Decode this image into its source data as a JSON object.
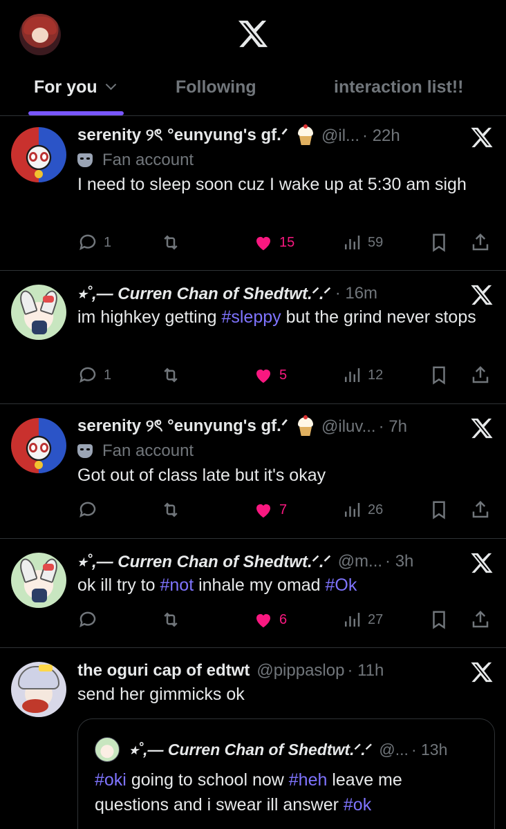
{
  "header": {
    "tabs": [
      "For you",
      "Following",
      "interaction list!!"
    ],
    "active_tab": "For you"
  },
  "posts": [
    {
      "name": "serenity ୨ৎ °eunyung's gf.ᐟ",
      "handle": "@il...",
      "time": "· 22h",
      "badge": "Fan account",
      "text": "I need to sleep soon cuz I wake up at 5:30 am sigh",
      "reply_count": "1",
      "like_count": "15",
      "view_count": "59"
    },
    {
      "name": "⭑˚,— Curren Chan of Shedtwt.ᐟ.ᐟ",
      "time": "· 16m",
      "text_parts": [
        "im highkey getting ",
        "#sleppy",
        " but the grind never stops"
      ],
      "reply_count": "1",
      "like_count": "5",
      "view_count": "12"
    },
    {
      "name": "serenity ୨ৎ °eunyung's gf.ᐟ",
      "handle": "@iluv...",
      "time": "· 7h",
      "badge": "Fan account",
      "text": "Got out of class late but it's okay",
      "like_count": "7",
      "view_count": "26"
    },
    {
      "name": "⭑˚,— Curren Chan of Shedtwt.ᐟ.ᐟ",
      "handle": "@m...",
      "time": "· 3h",
      "text_parts": [
        "ok ill try to ",
        "#not",
        " inhale my omad ",
        "#Ok"
      ],
      "like_count": "6",
      "view_count": "27"
    },
    {
      "name": "the oguri cap of edtwt",
      "handle": "@pippaslop",
      "time": "· 11h",
      "text": "send her gimmicks ok",
      "quote": {
        "name": "⭑˚,— Curren Chan of Shedtwt.ᐟ.ᐟ",
        "handle": "@...",
        "time": "· 13h",
        "text_parts": [
          "#oki",
          " going to school now ",
          "#heh",
          " leave me questions and i swear ill answer ",
          "#ok"
        ]
      }
    }
  ],
  "colors": {
    "accent": "#7856ff",
    "like": "#f91880",
    "hashtag": "#7f74ff",
    "muted": "#71767b"
  }
}
